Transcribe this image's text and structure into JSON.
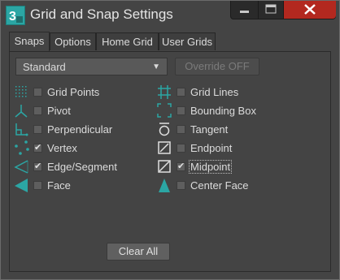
{
  "window": {
    "title": "Grid and Snap Settings",
    "app_icon": {
      "name": "3ds-max-icon",
      "glyph": "3",
      "color": "#2ba6a4"
    },
    "controls": [
      "minimize-icon",
      "maximize-icon",
      "close-icon"
    ]
  },
  "tabs": [
    {
      "label": "Snaps",
      "active": true
    },
    {
      "label": "Options",
      "active": false
    },
    {
      "label": "Home Grid",
      "active": false
    },
    {
      "label": "User Grids",
      "active": false
    }
  ],
  "toolbar": {
    "preset": "Standard",
    "override_label": "Override OFF"
  },
  "snaps": {
    "left": [
      {
        "label": "Grid Points",
        "checked": false,
        "icon": "grid-points-icon"
      },
      {
        "label": "Pivot",
        "checked": false,
        "icon": "pivot-icon"
      },
      {
        "label": "Perpendicular",
        "checked": false,
        "icon": "perpendicular-icon"
      },
      {
        "label": "Vertex",
        "checked": true,
        "icon": "vertex-icon"
      },
      {
        "label": "Edge/Segment",
        "checked": true,
        "icon": "edge-segment-icon"
      },
      {
        "label": "Face",
        "checked": false,
        "icon": "face-icon"
      }
    ],
    "right": [
      {
        "label": "Grid Lines",
        "checked": false,
        "icon": "grid-lines-icon"
      },
      {
        "label": "Bounding Box",
        "checked": false,
        "icon": "bounding-box-icon"
      },
      {
        "label": "Tangent",
        "checked": false,
        "icon": "tangent-icon"
      },
      {
        "label": "Endpoint",
        "checked": false,
        "icon": "endpoint-icon"
      },
      {
        "label": "Midpoint",
        "checked": true,
        "icon": "midpoint-icon"
      },
      {
        "label": "Center Face",
        "checked": false,
        "icon": "center-face-icon"
      }
    ]
  },
  "clear_all_label": "Clear All",
  "colors": {
    "background": "#444444",
    "accent": "#2ba6a4",
    "close_button": "#b3281f",
    "text": "#dcdcdc"
  }
}
